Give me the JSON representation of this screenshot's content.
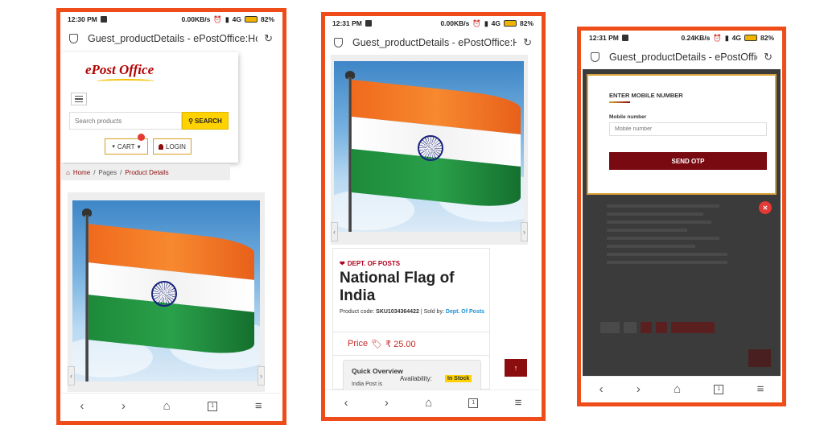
{
  "phones": [
    {
      "status": {
        "time": "12:30 PM",
        "net": "0.00KB/s",
        "signal": "4G",
        "battery": "82%"
      },
      "address": "Guest_productDetails - ePostOffice:Ho",
      "logo": {
        "e": "e",
        "rest": "Post Office"
      },
      "search": {
        "placeholder": "Search products",
        "button": "SEARCH"
      },
      "cart_label": "CART",
      "login_label": "LOGIN",
      "breadcrumb": {
        "home": "Home",
        "pages": "Pages",
        "current": "Product Details"
      }
    },
    {
      "status": {
        "time": "12:31 PM",
        "net": "0.00KB/s",
        "signal": "4G",
        "battery": "82%"
      },
      "address": "Guest_productDetails - ePostOffice:Ho",
      "dept": "DEPT. OF POSTS",
      "title": "National Flag of India",
      "product_code_label": "Product code:",
      "product_code": "SKU1034364422",
      "sold_by_label": "| Sold by:",
      "sold_by": "Dept. Of Posts",
      "price_label": "Price",
      "price": "₹ 25.00",
      "overview_title": "Quick Overview",
      "overview_text": "India Post is",
      "availability_label": "Availability:",
      "availability": "In Stock"
    },
    {
      "status": {
        "time": "12:31 PM",
        "net": "0.24KB/s",
        "signal": "4G",
        "battery": "82%"
      },
      "address": "Guest_productDetails - ePostOffice:Ho",
      "modal_title": "ENTER MOBILE NUMBER",
      "mobile_label": "Mobile number",
      "mobile_placeholder": "Mobile number",
      "send_otp": "SEND OTP"
    }
  ],
  "icons": {
    "back": "‹",
    "forward": "›",
    "home": "⌂",
    "tabs": "1",
    "menu": "≡",
    "reload": "↻",
    "search": "⚲",
    "cart": "🛒",
    "user": "👤",
    "close": "✕",
    "up": "↑"
  },
  "colors": {
    "frame": "#ee4d1a",
    "brand_red": "#8b0d0d",
    "yellow": "#ffd200"
  }
}
